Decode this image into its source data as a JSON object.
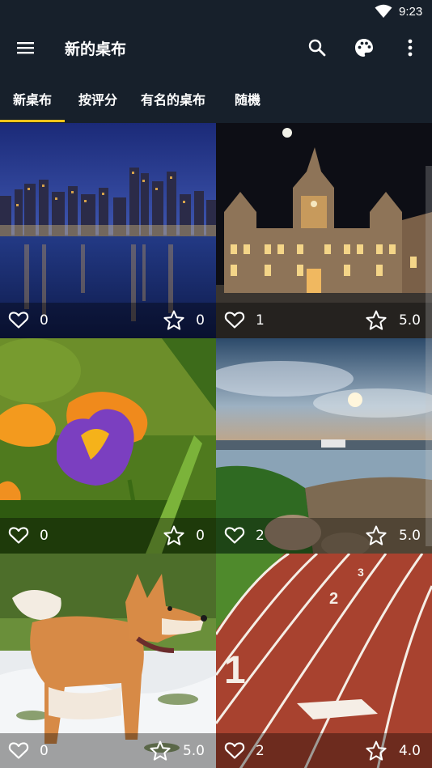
{
  "status": {
    "time": "9:23"
  },
  "appbar": {
    "title": "新的桌布"
  },
  "tabs": [
    {
      "label": "新桌布",
      "selected": true
    },
    {
      "label": "按评分",
      "selected": false
    },
    {
      "label": "有名的桌布",
      "selected": false
    },
    {
      "label": "随機",
      "selected": false
    }
  ],
  "colors": {
    "accent": "#f0c419",
    "bar": "#17202b"
  },
  "wallpapers": [
    {
      "subject": "city-skyline-night",
      "favorites": "0",
      "rating": "0"
    },
    {
      "subject": "palace-night",
      "favorites": "1",
      "rating": "5.0"
    },
    {
      "subject": "purple-crocus",
      "favorites": "0",
      "rating": "0"
    },
    {
      "subject": "harbor-sunset",
      "favorites": "2",
      "rating": "5.0"
    },
    {
      "subject": "shiba-dog-snow",
      "favorites": "0",
      "rating": "5.0"
    },
    {
      "subject": "running-track",
      "favorites": "2",
      "rating": "4.0"
    }
  ]
}
